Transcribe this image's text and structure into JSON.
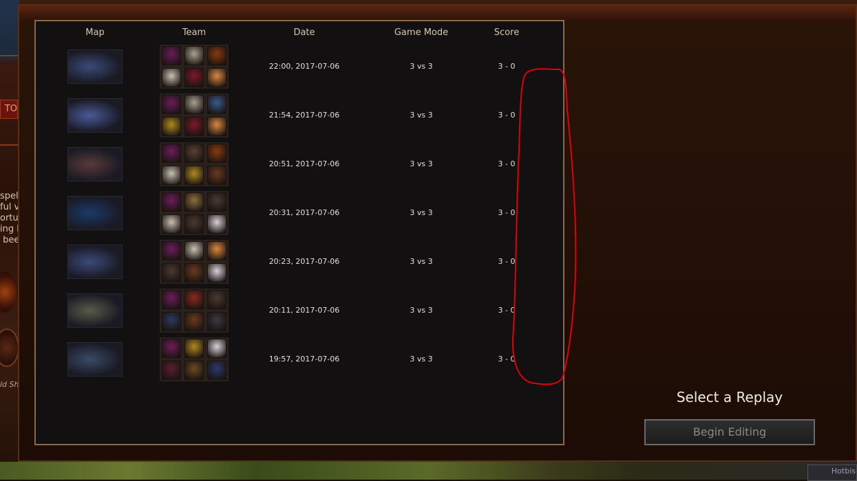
{
  "columns": {
    "map": "Map",
    "team": "Team",
    "date": "Date",
    "mode": "Game Mode",
    "score": "Score"
  },
  "rows": [
    {
      "date": "22:00, 2017-07-06",
      "mode": "3 vs 3",
      "score": "3 - 0",
      "map_tint": "#3a4a78",
      "heroes": [
        "#6a1e5a",
        "#a8a090",
        "#8a3a10",
        "#c8c0b0",
        "#7a1a2a",
        "#d88840"
      ]
    },
    {
      "date": "21:54, 2017-07-06",
      "mode": "3 vs 3",
      "score": "3 - 0",
      "map_tint": "#4a5a98",
      "heroes": [
        "#6a1e5a",
        "#a8a090",
        "#3a5a8a",
        "#b08a20",
        "#7a1a2a",
        "#d88840"
      ]
    },
    {
      "date": "20:51, 2017-07-06",
      "mode": "3 vs 3",
      "score": "3 - 0",
      "map_tint": "#5a3a3a",
      "heroes": [
        "#6a1e5a",
        "#5a4030",
        "#8a3a10",
        "#c8c0b0",
        "#b08a20",
        "#6a3a20"
      ]
    },
    {
      "date": "20:31, 2017-07-06",
      "mode": "3 vs 3",
      "score": "3 - 0",
      "map_tint": "#1a3a6a",
      "heroes": [
        "#6a1e5a",
        "#8a7040",
        "#4a3a30",
        "#c8c0b0",
        "#4a3a30",
        "#d8d0d8"
      ]
    },
    {
      "date": "20:23, 2017-07-06",
      "mode": "3 vs 3",
      "score": "3 - 0",
      "map_tint": "#3a4a78",
      "heroes": [
        "#6a1e5a",
        "#c8c0b0",
        "#d88840",
        "#4a3a30",
        "#6a3a20",
        "#d8d0d8"
      ]
    },
    {
      "date": "20:11, 2017-07-06",
      "mode": "3 vs 3",
      "score": "3 - 0",
      "map_tint": "#5a5a4a",
      "heroes": [
        "#6a1e5a",
        "#8a2a20",
        "#4a3a30",
        "#2a3a5a",
        "#6a3a20",
        "#3a3a40"
      ]
    },
    {
      "date": "19:57, 2017-07-06",
      "mode": "3 vs 3",
      "score": "3 - 0",
      "map_tint": "#3a4a68",
      "heroes": [
        "#6a1e5a",
        "#b08a20",
        "#d8d0d8",
        "#5a2030",
        "#6a4a20",
        "#2a3a6a"
      ]
    }
  ],
  "right_panel": {
    "title": "Select a Replay",
    "button": "Begin Editing"
  },
  "annotation_color": "#e00010",
  "background": {
    "left_text": "spel\nful v\nortu\ning h\n bee",
    "left_badge": "TO",
    "left_caption": "ld Sh",
    "bottom_chip": "Hotbis"
  }
}
